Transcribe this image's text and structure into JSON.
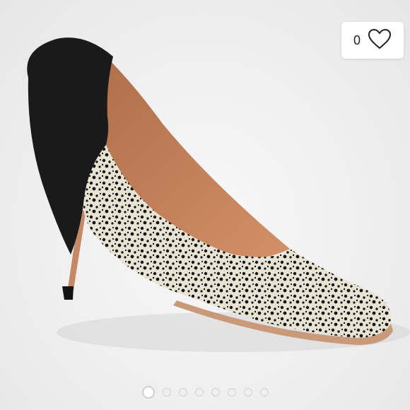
{
  "listing": {
    "likes_count": "0",
    "image_icon": "leopard-print-pointed-pump-photo",
    "like_icon": "heart-outline-icon"
  },
  "carousel": {
    "total_images": 8,
    "active_index": 0
  },
  "colors": {
    "background": "#ececec",
    "dot_border": "#d2d2d2"
  }
}
